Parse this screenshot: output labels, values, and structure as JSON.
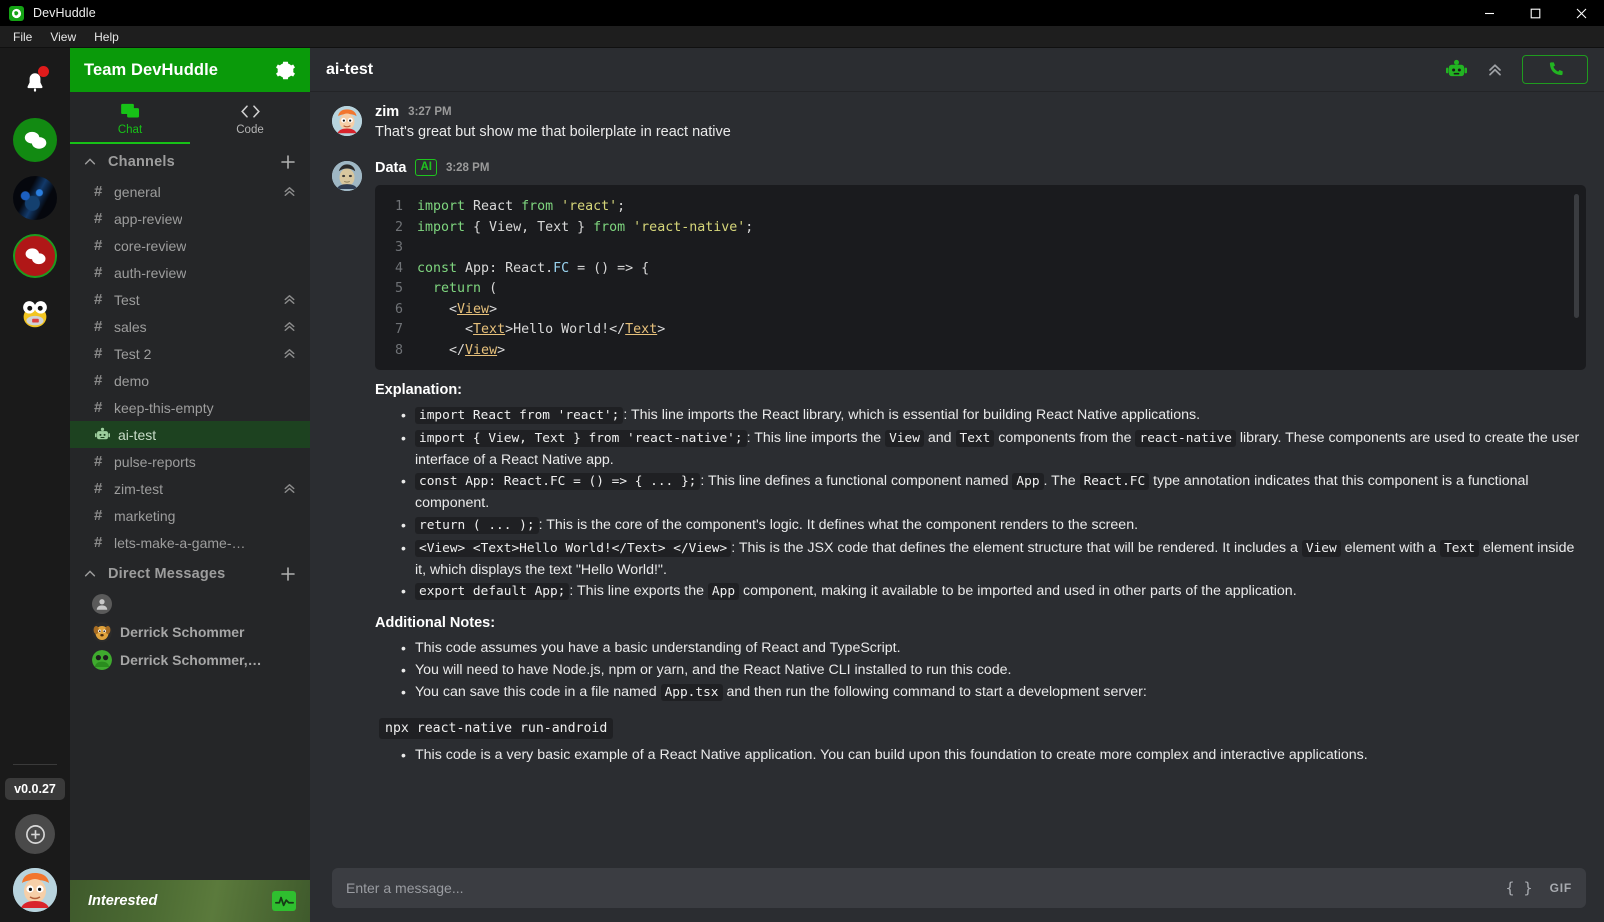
{
  "window": {
    "app_title": "DevHuddle",
    "logo_icon": "devhuddle-logo-icon",
    "controls": {
      "minimize": "minimize-icon",
      "maximize": "maximize-icon",
      "close": "close-icon"
    }
  },
  "menubar": {
    "items": [
      "File",
      "View",
      "Help"
    ]
  },
  "rail": {
    "bell_icon": "notification-bell-icon",
    "workspaces": [
      {
        "name": "chat-workspace",
        "icon": "chat-bubbles-icon",
        "style": "green"
      },
      {
        "name": "dragon-workspace",
        "icon": "dragon-avatar-icon",
        "style": "image"
      },
      {
        "name": "alerts-workspace",
        "icon": "chat-bubbles-icon",
        "style": "red-active"
      },
      {
        "name": "koopa-workspace",
        "icon": "koopa-avatar-icon",
        "style": "image"
      }
    ],
    "version": "v0.0.27",
    "add_workspace_icon": "plus-circle-icon",
    "user_avatar_icon": "user-avatar-icon"
  },
  "sidebar": {
    "team_name": "Team DevHuddle",
    "settings_icon": "gear-icon",
    "tabs": [
      {
        "label": "Chat",
        "icon": "chat-icon",
        "active": true
      },
      {
        "label": "Code",
        "icon": "code-brackets-icon",
        "active": false
      }
    ],
    "channels_section": {
      "title": "Channels",
      "caret_icon": "chevron-up-icon",
      "add_icon": "plus-icon",
      "items": [
        {
          "label": "general",
          "icon": "hash-icon",
          "badge": "double-chevron-up-icon",
          "active": false
        },
        {
          "label": "app-review",
          "icon": "hash-icon",
          "badge": "",
          "active": false
        },
        {
          "label": "core-review",
          "icon": "hash-icon",
          "badge": "",
          "active": false
        },
        {
          "label": "auth-review",
          "icon": "hash-icon",
          "badge": "",
          "active": false
        },
        {
          "label": "Test",
          "icon": "hash-icon",
          "badge": "double-chevron-up-icon",
          "active": false
        },
        {
          "label": "sales",
          "icon": "hash-icon",
          "badge": "double-chevron-up-icon",
          "active": false
        },
        {
          "label": "Test 2",
          "icon": "hash-icon",
          "badge": "double-chevron-up-icon",
          "active": false
        },
        {
          "label": "demo",
          "icon": "hash-icon",
          "badge": "",
          "active": false
        },
        {
          "label": "keep-this-empty",
          "icon": "hash-icon",
          "badge": "",
          "active": false
        },
        {
          "label": "ai-test",
          "icon": "robot-icon",
          "badge": "",
          "active": true
        },
        {
          "label": "pulse-reports",
          "icon": "hash-icon",
          "badge": "",
          "active": false
        },
        {
          "label": "zim-test",
          "icon": "hash-icon",
          "badge": "double-chevron-up-icon",
          "active": false
        },
        {
          "label": "marketing",
          "icon": "hash-icon",
          "badge": "",
          "active": false
        },
        {
          "label": "lets-make-a-game-…",
          "icon": "hash-icon",
          "badge": "",
          "active": false
        }
      ]
    },
    "dm_section": {
      "title": "Direct Messages",
      "caret_icon": "chevron-up-icon",
      "add_icon": "plus-icon",
      "items": [
        {
          "label": "",
          "avatar": "blank-avatar-icon"
        },
        {
          "label": "Derrick Schommer",
          "avatar": "dog-avatar-icon"
        },
        {
          "label": "Derrick Schommer,…",
          "avatar": "group-avatar-icon"
        }
      ]
    },
    "banner": {
      "text": "Interested",
      "icon": "pulse-chart-icon"
    }
  },
  "main": {
    "channel_title": "ai-test",
    "header_icons": [
      {
        "name": "robot-icon",
        "label": "AI assistant"
      },
      {
        "name": "double-chevron-up-icon",
        "label": "Collapse"
      }
    ],
    "call_button_icon": "phone-icon",
    "messages": [
      {
        "author": "zim",
        "avatar": "fry-avatar-icon",
        "badge": "",
        "time": "3:27 PM",
        "text": "That's great but show me that boilerplate in react native"
      },
      {
        "author": "Data",
        "avatar": "data-avatar-icon",
        "badge": "AI",
        "time": "3:28 PM",
        "text": ""
      }
    ],
    "code_block": {
      "language": "tsx",
      "lines": [
        {
          "n": "1",
          "tokens": [
            {
              "t": "import ",
              "c": "k-kw"
            },
            {
              "t": "React ",
              "c": "k-plain"
            },
            {
              "t": "from ",
              "c": "k-kw"
            },
            {
              "t": "'react'",
              "c": "k-str"
            },
            {
              "t": ";",
              "c": "k-plain"
            }
          ]
        },
        {
          "n": "2",
          "tokens": [
            {
              "t": "import ",
              "c": "k-kw"
            },
            {
              "t": "{ View, Text } ",
              "c": "k-plain"
            },
            {
              "t": "from ",
              "c": "k-kw"
            },
            {
              "t": "'react-native'",
              "c": "k-str"
            },
            {
              "t": ";",
              "c": "k-plain"
            }
          ]
        },
        {
          "n": "3",
          "tokens": [
            {
              "t": "",
              "c": "k-plain"
            }
          ]
        },
        {
          "n": "4",
          "tokens": [
            {
              "t": "const ",
              "c": "k-kw"
            },
            {
              "t": "App: React.",
              "c": "k-plain"
            },
            {
              "t": "FC",
              "c": "k-type"
            },
            {
              "t": " = () => {",
              "c": "k-plain"
            }
          ]
        },
        {
          "n": "5",
          "tokens": [
            {
              "t": "  ",
              "c": "k-plain"
            },
            {
              "t": "return ",
              "c": "k-kw"
            },
            {
              "t": "(",
              "c": "k-plain"
            }
          ]
        },
        {
          "n": "6",
          "tokens": [
            {
              "t": "    <",
              "c": "k-plain"
            },
            {
              "t": "View",
              "c": "k-tag"
            },
            {
              "t": ">",
              "c": "k-plain"
            }
          ]
        },
        {
          "n": "7",
          "tokens": [
            {
              "t": "      <",
              "c": "k-plain"
            },
            {
              "t": "Text",
              "c": "k-tag"
            },
            {
              "t": ">Hello World!</",
              "c": "k-plain"
            },
            {
              "t": "Text",
              "c": "k-tag"
            },
            {
              "t": ">",
              "c": "k-plain"
            }
          ]
        },
        {
          "n": "8",
          "tokens": [
            {
              "t": "    </",
              "c": "k-plain"
            },
            {
              "t": "View",
              "c": "k-tag"
            },
            {
              "t": ">",
              "c": "k-plain"
            }
          ]
        }
      ]
    },
    "explanation": {
      "title": "Explanation:",
      "bullets": [
        [
          {
            "code": "import React from 'react';"
          },
          {
            "text": ": This line imports the React library, which is essential for building React Native applications."
          }
        ],
        [
          {
            "code": "import { View, Text } from 'react-native';"
          },
          {
            "text": ": This line imports the "
          },
          {
            "code": "View"
          },
          {
            "text": " and "
          },
          {
            "code": "Text"
          },
          {
            "text": " components from the "
          },
          {
            "code": "react-native"
          },
          {
            "text": " library. These components are used to create the user interface of a React Native app."
          }
        ],
        [
          {
            "code": "const App: React.FC = () => { ... };"
          },
          {
            "text": ": This line defines a functional component named "
          },
          {
            "code": "App"
          },
          {
            "text": ". The "
          },
          {
            "code": "React.FC"
          },
          {
            "text": " type annotation indicates that this component is a functional component."
          }
        ],
        [
          {
            "code": "return ( ... );"
          },
          {
            "text": ": This is the core of the component's logic. It defines what the component renders to the screen."
          }
        ],
        [
          {
            "code": "<View> <Text>Hello World!</Text> </View>"
          },
          {
            "text": ": This is the JSX code that defines the element structure that will be rendered. It includes a "
          },
          {
            "code": "View"
          },
          {
            "text": " element with a "
          },
          {
            "code": "Text"
          },
          {
            "text": " element inside it, which displays the text \"Hello World!\"."
          }
        ],
        [
          {
            "code": "export default App;"
          },
          {
            "text": ": This line exports the "
          },
          {
            "code": "App"
          },
          {
            "text": " component, making it available to be imported and used in other parts of the application."
          }
        ]
      ]
    },
    "additional_notes": {
      "title": "Additional Notes:",
      "bullets": [
        [
          {
            "text": "This code assumes you have a basic understanding of React and TypeScript."
          }
        ],
        [
          {
            "text": "You will need to have Node.js, npm or yarn, and the React Native CLI installed to run this code."
          }
        ],
        [
          {
            "text": "You can save this code in a file named "
          },
          {
            "code": "App.tsx"
          },
          {
            "text": " and then run the following command to start a development server:"
          }
        ]
      ],
      "command": "npx react-native run-android",
      "closing_bullets": [
        [
          {
            "text": "This code is a very basic example of a React Native application. You can build upon this foundation to create more complex and interactive applications."
          }
        ]
      ]
    },
    "composer": {
      "placeholder": "Enter a message...",
      "code_icon": "code-braces-icon",
      "gif_icon": "GIF"
    }
  },
  "colors": {
    "brand_green": "#0a9a0a",
    "accent_green": "#17c117",
    "active_channel_bg": "#1d4220",
    "sidebar_bg": "#252628",
    "main_bg": "#2b2d31",
    "code_bg": "#1a1b1e",
    "notification_red": "#e01b1b"
  }
}
